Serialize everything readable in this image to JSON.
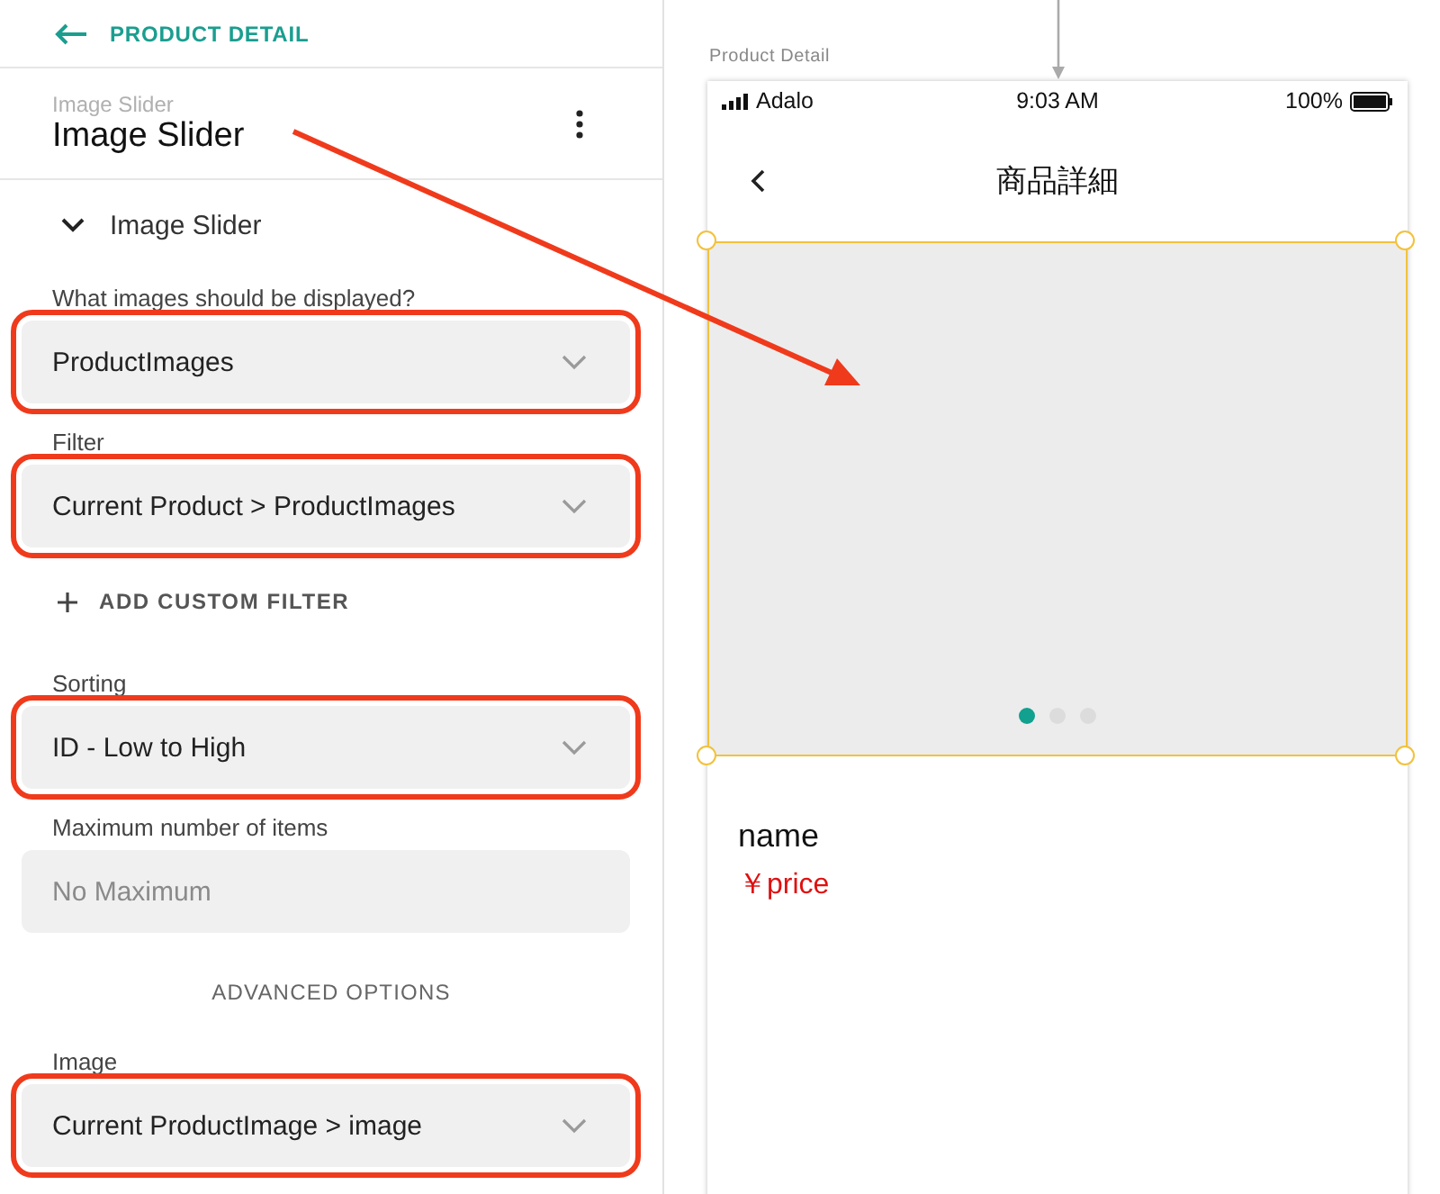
{
  "header": {
    "back_label": "PRODUCT DETAIL"
  },
  "component": {
    "type_label": "Image Slider",
    "name": "Image Slider"
  },
  "section": {
    "title": "Image Slider",
    "expanded": true
  },
  "fields": [
    {
      "kind": "dropdown",
      "label": "What images should be displayed?",
      "value": "ProductImages",
      "highlighted": true
    },
    {
      "kind": "dropdown",
      "label": "Filter",
      "value": "Current Product > ProductImages",
      "highlighted": true
    },
    {
      "kind": "action",
      "label": "ADD CUSTOM FILTER"
    },
    {
      "kind": "dropdown",
      "label": "Sorting",
      "value": "ID - Low to High",
      "highlighted": true
    },
    {
      "kind": "input",
      "label": "Maximum number of items",
      "placeholder": "No Maximum",
      "highlighted": false
    },
    {
      "kind": "heading",
      "label": "ADVANCED OPTIONS"
    },
    {
      "kind": "dropdown",
      "label": "Image",
      "value": "Current ProductImage > image",
      "highlighted": true
    }
  ],
  "preview": {
    "screen_label": "Product Detail",
    "status_bar": {
      "carrier": "Adalo",
      "time": "9:03 AM",
      "battery": "100%"
    },
    "nav_title": "商品詳細",
    "slider": {
      "selected": true,
      "dots": [
        {
          "selected": true
        },
        {
          "selected": false
        },
        {
          "selected": false
        }
      ]
    },
    "product_name": "name",
    "product_price": "￥price"
  }
}
